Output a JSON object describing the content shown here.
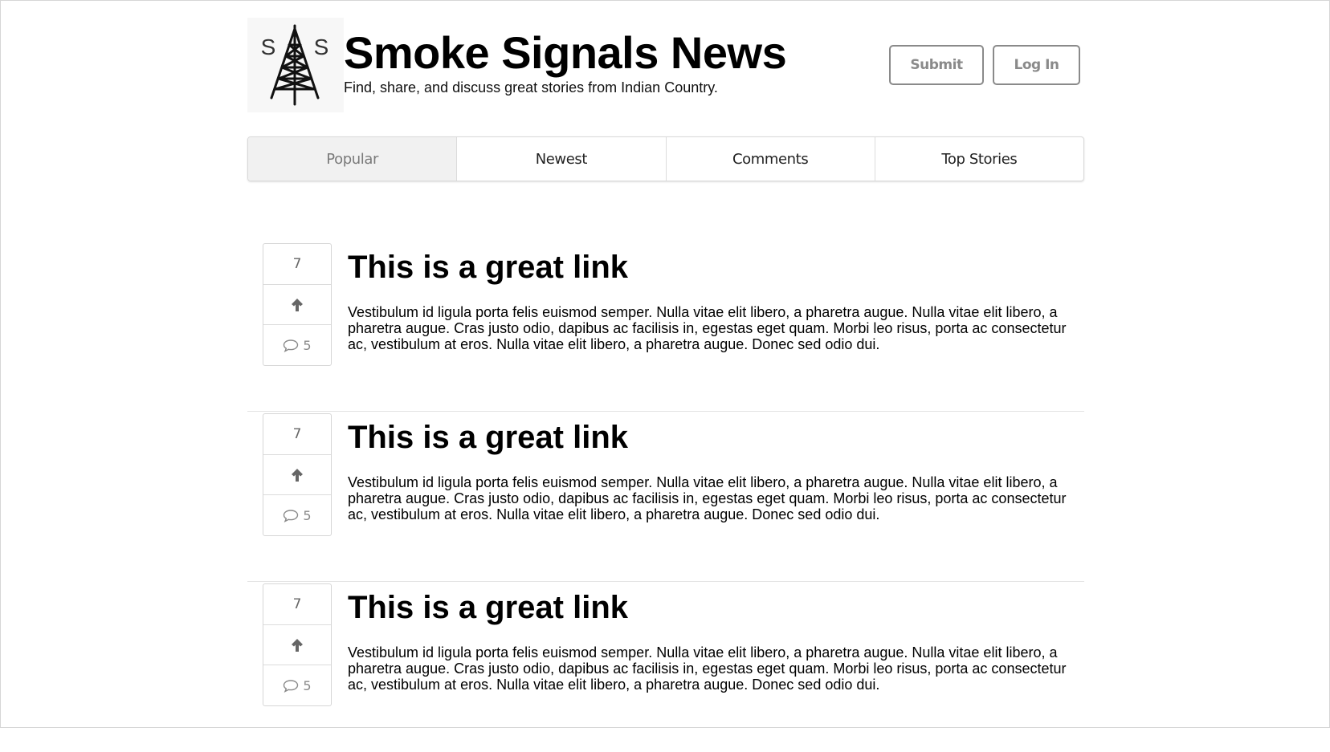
{
  "header": {
    "title": "Smoke Signals News",
    "tagline": "Find, share, and discuss great stories from Indian Country.",
    "logo_letters": [
      "S",
      "S"
    ],
    "submit_label": "Submit",
    "login_label": "Log In"
  },
  "tabs": [
    {
      "label": "Popular",
      "active": true
    },
    {
      "label": "Newest",
      "active": false
    },
    {
      "label": "Comments",
      "active": false
    },
    {
      "label": "Top Stories",
      "active": false
    }
  ],
  "stories": [
    {
      "votes": "7",
      "comments": "5",
      "title": "This is a great link",
      "body": "Vestibulum id ligula porta felis euismod semper. Nulla vitae elit libero, a pharetra augue. Nulla vitae elit libero, a pharetra augue. Cras justo odio, dapibus ac facilisis in, egestas eget quam. Morbi leo risus, porta ac consectetur ac, vestibulum at eros. Nulla vitae elit libero, a pharetra augue. Donec sed odio dui."
    },
    {
      "votes": "7",
      "comments": "5",
      "title": "This is a great link",
      "body": "Vestibulum id ligula porta felis euismod semper. Nulla vitae elit libero, a pharetra augue. Nulla vitae elit libero, a pharetra augue. Cras justo odio, dapibus ac facilisis in, egestas eget quam. Morbi leo risus, porta ac consectetur ac, vestibulum at eros. Nulla vitae elit libero, a pharetra augue. Donec sed odio dui."
    },
    {
      "votes": "7",
      "comments": "5",
      "title": "This is a great link",
      "body": "Vestibulum id ligula porta felis euismod semper. Nulla vitae elit libero, a pharetra augue. Nulla vitae elit libero, a pharetra augue. Cras justo odio, dapibus ac facilisis in, egestas eget quam. Morbi leo risus, porta ac consectetur ac, vestibulum at eros. Nulla vitae elit libero, a pharetra augue. Donec sed odio dui."
    }
  ],
  "icons": {
    "logo": "radio-tower-icon",
    "upvote": "arrow-up-icon",
    "comments": "speech-bubble-icon"
  },
  "colors": {
    "button_border": "#8a8a8a",
    "active_tab_bg": "#f1f1f1",
    "divider": "#e3e3e3"
  }
}
